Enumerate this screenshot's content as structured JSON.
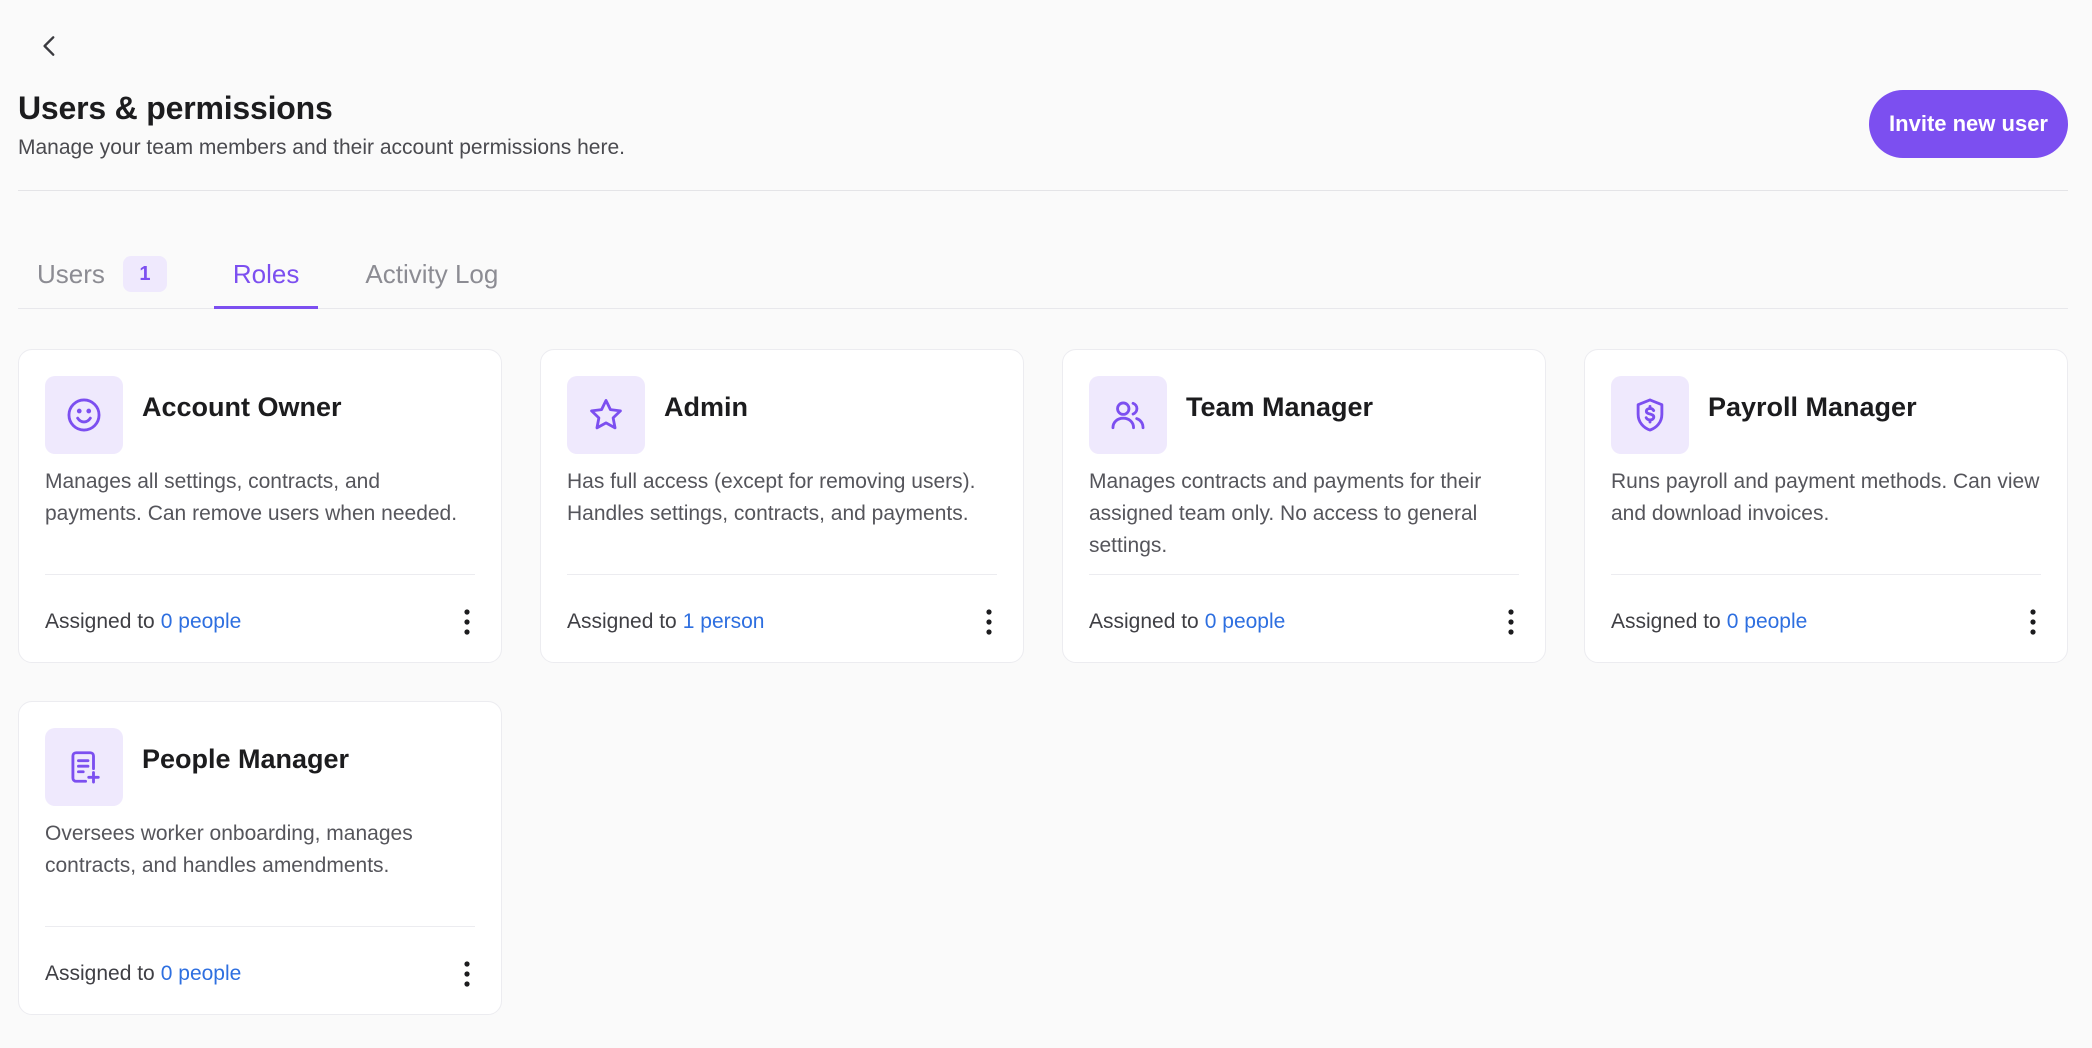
{
  "header": {
    "title": "Users & permissions",
    "subtitle": "Manage your team members and their account permissions here.",
    "invite_button": "Invite new user"
  },
  "tabs": [
    {
      "label": "Users",
      "badge": "1"
    },
    {
      "label": "Roles",
      "active": true
    },
    {
      "label": "Activity Log"
    }
  ],
  "roles": [
    {
      "name": "Account Owner",
      "icon": "smile-icon",
      "description": "Manages all settings, contracts, and payments. Can remove users when needed.",
      "assigned_label": "Assigned to",
      "assigned_count": "0 people"
    },
    {
      "name": "Admin",
      "icon": "star-icon",
      "description": "Has full access (except for removing users). Handles settings, contracts, and payments.",
      "assigned_label": "Assigned to",
      "assigned_count": "1 person"
    },
    {
      "name": "Team Manager",
      "icon": "users-icon",
      "description": "Manages contracts and payments for their assigned team only. No access to general settings.",
      "assigned_label": "Assigned to",
      "assigned_count": "0 people"
    },
    {
      "name": "Payroll Manager",
      "icon": "shield-dollar-icon",
      "description": "Runs payroll and payment methods. Can view and download invoices.",
      "assigned_label": "Assigned to",
      "assigned_count": "0 people"
    },
    {
      "name": "People Manager",
      "icon": "document-add-icon",
      "description": "Oversees worker onboarding, manages contracts, and handles amendments.",
      "assigned_label": "Assigned to",
      "assigned_count": "0 people"
    }
  ],
  "colors": {
    "accent": "#7c4ff0",
    "accent_light": "#efe9fd",
    "link": "#2e6fe0",
    "background": "#fafafa"
  }
}
